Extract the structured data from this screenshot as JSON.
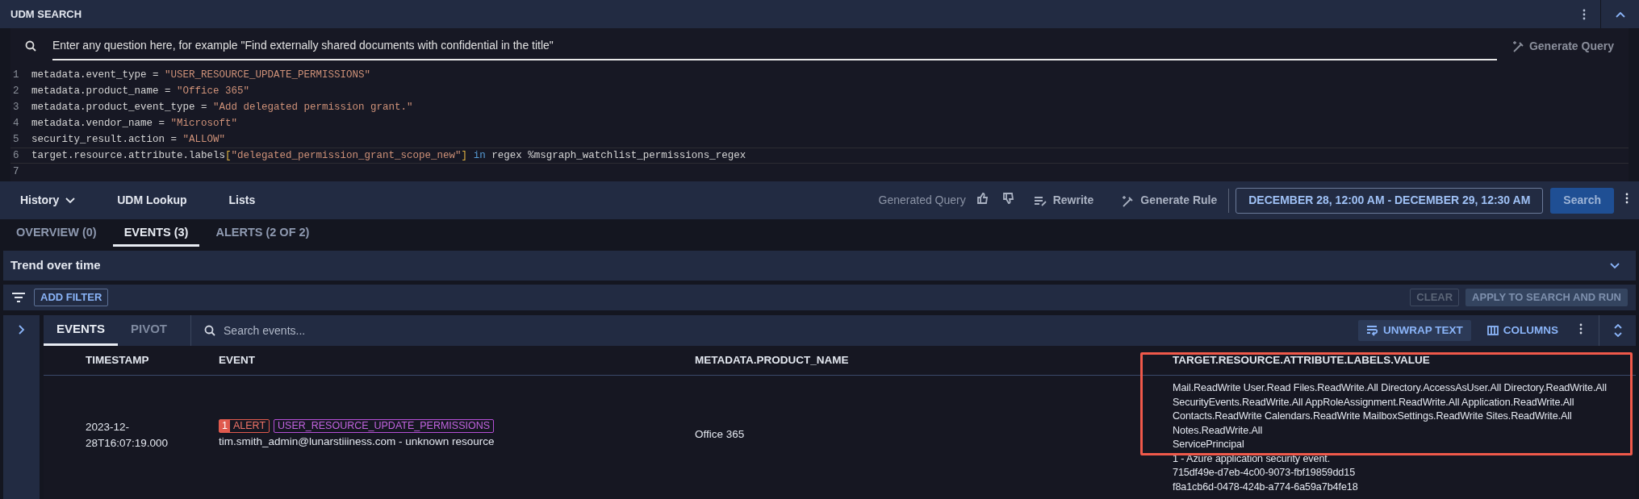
{
  "panel": {
    "title": "UDM SEARCH"
  },
  "question": {
    "placeholder": "Enter any question here, for example \"Find externally shared documents with confidential in the title\"",
    "generate_label": "Generate Query"
  },
  "editor": {
    "lines": [
      {
        "number": "1",
        "tokens": [
          {
            "kind": "plain",
            "text": "metadata.event_type = "
          },
          {
            "kind": "string",
            "text": "\"USER_RESOURCE_UPDATE_PERMISSIONS\""
          }
        ]
      },
      {
        "number": "2",
        "tokens": [
          {
            "kind": "plain",
            "text": "metadata.product_name = "
          },
          {
            "kind": "string",
            "text": "\"Office 365\""
          }
        ]
      },
      {
        "number": "3",
        "tokens": [
          {
            "kind": "plain",
            "text": "metadata.product_event_type = "
          },
          {
            "kind": "string",
            "text": "\"Add delegated permission grant.\""
          }
        ]
      },
      {
        "number": "4",
        "tokens": [
          {
            "kind": "plain",
            "text": "metadata.vendor_name = "
          },
          {
            "kind": "string",
            "text": "\"Microsoft\""
          }
        ]
      },
      {
        "number": "5",
        "tokens": [
          {
            "kind": "plain",
            "text": "security_result.action = "
          },
          {
            "kind": "string",
            "text": "\"ALLOW\""
          }
        ]
      },
      {
        "number": "6",
        "tokens": [
          {
            "kind": "plain",
            "text": "target.resource.attribute.labels"
          },
          {
            "kind": "bracket",
            "text": "["
          },
          {
            "kind": "string",
            "text": "\"delegated_permission_grant_scope_new\""
          },
          {
            "kind": "bracket",
            "text": "]"
          },
          {
            "kind": "keyword",
            "text": " in"
          },
          {
            "kind": "plain",
            "text": " regex %msgraph_watchlist_permissions_regex"
          }
        ]
      },
      {
        "number": "7"
      }
    ]
  },
  "toolbar": {
    "left": [
      {
        "label": "History",
        "dropdown": true
      },
      {
        "label": "UDM Lookup",
        "dropdown": false
      },
      {
        "label": "Lists",
        "dropdown": false
      }
    ],
    "generated_label": "Generated Query",
    "rewrite": "Rewrite",
    "generate_rule": "Generate Rule",
    "date_range": "DECEMBER 28, 12:00 AM - DECEMBER 29, 12:30 AM",
    "search": "Search"
  },
  "tabs": [
    {
      "label": "OVERVIEW (0)",
      "selected": false
    },
    {
      "label": "EVENTS (3)",
      "selected": true
    },
    {
      "label": "ALERTS (2 OF 2)",
      "selected": false
    }
  ],
  "trend": {
    "title": "Trend over time"
  },
  "filters": {
    "add": "ADD FILTER",
    "clear": "CLEAR",
    "apply": "APPLY TO SEARCH AND RUN"
  },
  "events": {
    "subtabs": [
      {
        "label": "EVENTS",
        "selected": true
      },
      {
        "label": "PIVOT",
        "selected": false
      }
    ],
    "search_placeholder": "Search events...",
    "unwrap": "UNWRAP TEXT",
    "columns_button": "COLUMNS",
    "columns": [
      "TIMESTAMP",
      "EVENT",
      "METADATA.PRODUCT_NAME",
      "TARGET.RESOURCE.ATTRIBUTE.LABELS.VALUE"
    ],
    "highlight_frame": true,
    "rows": [
      {
        "timestamp": "2023-12-28T16:07:19.000",
        "alert_count": "1",
        "alert_label": "ALERT",
        "event_type": "USER_RESOURCE_UPDATE_PERMISSIONS",
        "description": "tim.smith_admin@lunarstiiiness.com - unknown resource",
        "product": "Office 365",
        "values": [
          "Mail.ReadWrite User.Read Files.ReadWrite.All Directory.AccessAsUser.All Directory.ReadWrite.All",
          "SecurityEvents.ReadWrite.All AppRoleAssignment.ReadWrite.All Application.ReadWrite.All",
          "Contacts.ReadWrite Calendars.ReadWrite MailboxSettings.ReadWrite Sites.ReadWrite.All",
          "Notes.ReadWrite.All",
          "ServicePrincipal",
          "1 - Azure application security event.",
          "715df49e-d7eb-4c00-9073-fbf19859dd15",
          "f8a1cb6d-0478-424b-a774-6a59a7b4fe18"
        ]
      }
    ]
  }
}
